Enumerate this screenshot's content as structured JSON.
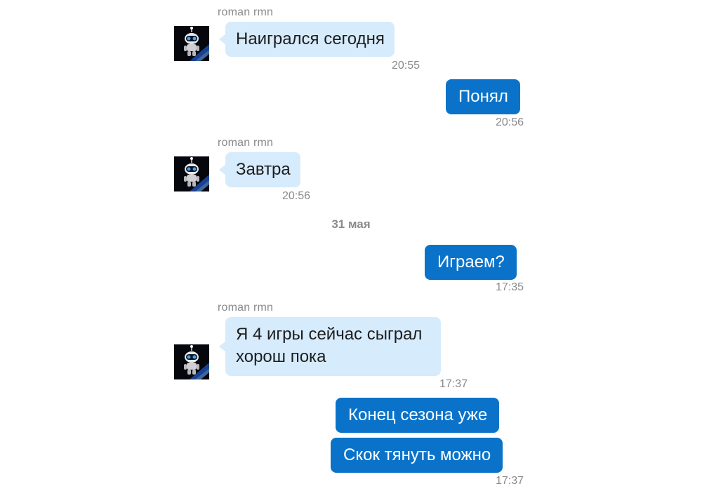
{
  "messages": [
    {
      "direction": "incoming",
      "sender": "roman rmn",
      "text": "Наигрался сегодня",
      "time": "20:55"
    },
    {
      "direction": "outgoing",
      "text": "Понял",
      "time": "20:56"
    },
    {
      "direction": "incoming",
      "sender": "roman rmn",
      "text": "Завтра",
      "time": "20:56"
    },
    {
      "date_separator": "31 мая"
    },
    {
      "direction": "outgoing",
      "text": "Играем?",
      "time": "17:35"
    },
    {
      "direction": "incoming",
      "sender": "roman rmn",
      "text_lines": [
        "Я 4 игры сейчас сыграл",
        "хорош пока"
      ],
      "time": "17:37"
    },
    {
      "direction": "outgoing",
      "text": "Конец сезона уже"
    },
    {
      "direction": "outgoing",
      "text": "Скок тянуть можно",
      "time": "17:37"
    }
  ],
  "colors": {
    "incoming_bubble": "#d6ebfb",
    "outgoing_bubble": "#0a73c9",
    "meta_text": "#8a8a8e"
  },
  "icons": {
    "avatar": "astronaut-robot-avatar"
  }
}
